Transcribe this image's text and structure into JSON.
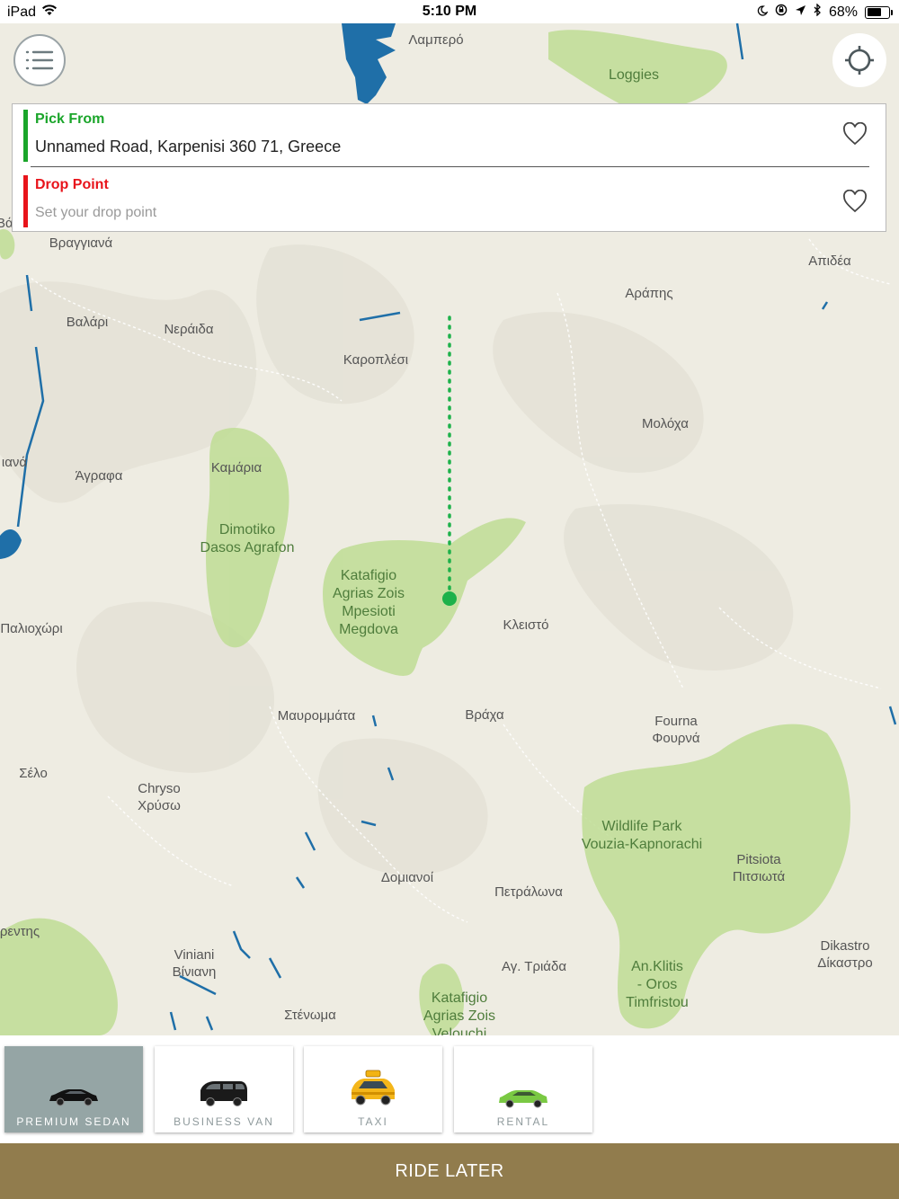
{
  "status_bar": {
    "device": "iPad",
    "time": "5:10 PM",
    "battery": "68%",
    "battery_level": 0.68,
    "icons": [
      "wifi-icon",
      "moon-icon",
      "rotation-lock-icon",
      "location-arrow-icon",
      "bluetooth-icon",
      "battery-icon"
    ]
  },
  "map": {
    "places": [
      {
        "name": "Λαμπερό"
      },
      {
        "name": "Loggies",
        "park": true
      },
      {
        "name": "Βραγγιανά"
      },
      {
        "name": "Απιδέα"
      },
      {
        "name": "Αράπης"
      },
      {
        "name": "Βαλάρι"
      },
      {
        "name": "Νεράιδα"
      },
      {
        "name": "Καροπλέσι"
      },
      {
        "name": "Μολόχα"
      },
      {
        "name": "Καμάρια"
      },
      {
        "name": "Άγραφα"
      },
      {
        "name": "Dimotiko\nDasos Agrafon",
        "park": true
      },
      {
        "name": "Katafigio\nAgrias Zois\nMpesioti\nMegdova",
        "park": true
      },
      {
        "name": "Κλειστό"
      },
      {
        "name": "Παλιοχώρι"
      },
      {
        "name": "Μαυρομμάτα"
      },
      {
        "name": "Βράχα"
      },
      {
        "name": "Fourna\nΦουρνά"
      },
      {
        "name": "Σέλο"
      },
      {
        "name": "Chryso\nΧρύσω"
      },
      {
        "name": "Wildlife Park",
        "park": true
      },
      {
        "name": "Vouzia-Kapnorachi",
        "park": true
      },
      {
        "name": "Pitsiota\nΠιτσιωτά"
      },
      {
        "name": "Δομιανοί"
      },
      {
        "name": "Πετράλωνα"
      },
      {
        "name": "ρεντης"
      },
      {
        "name": "Dikastro\nΔίκαστρο"
      },
      {
        "name": "Viniani\nΒίνιανη"
      },
      {
        "name": "Αγ. Τριάδα"
      },
      {
        "name": "An.Klitis\n- Oros\nTimfristou",
        "park": true
      },
      {
        "name": "Στένωμα"
      },
      {
        "name": "Katafigio\nAgrias Zois\nVelouchi",
        "park": true
      },
      {
        "name": "ιανά"
      },
      {
        "name": "Βάσ"
      }
    ]
  },
  "controls": {
    "menu_icon": "menu-icon",
    "locate_icon": "crosshair-icon"
  },
  "pickup": {
    "label": "Pick From",
    "value": "Unnamed Road, Karpenisi 360 71, Greece",
    "color": "#1aa52a"
  },
  "dropoff": {
    "label": "Drop Point",
    "placeholder": "Set your drop point",
    "color": "#e8141b"
  },
  "vehicles": [
    {
      "name": "PREMIUM SEDAN",
      "icon": "sedan-car-icon",
      "selected": true
    },
    {
      "name": "BUSINESS VAN",
      "icon": "van-icon",
      "selected": false
    },
    {
      "name": "TAXI",
      "icon": "taxi-icon",
      "selected": false
    },
    {
      "name": "RENTAL",
      "icon": "rental-car-icon",
      "selected": false
    }
  ],
  "action": {
    "ride_later": "RIDE LATER",
    "color": "#917c4d"
  }
}
